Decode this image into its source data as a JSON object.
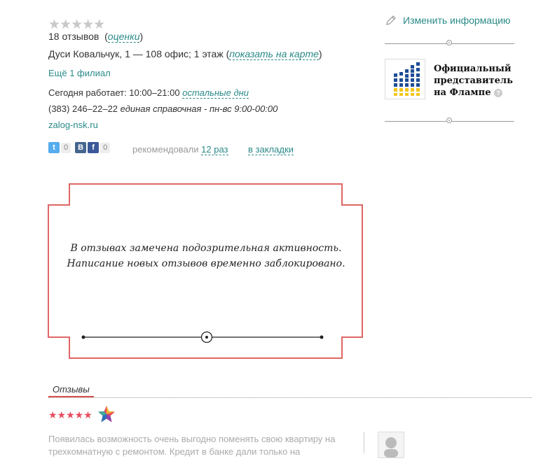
{
  "rating": {
    "stars": "★★★★★"
  },
  "reviews": {
    "count_text": "18 отзывов",
    "rate_link": "оценки"
  },
  "address": {
    "text": "Дуси Ковальчук, 1 — 108 офис; 1 этаж",
    "map_link": "показать на карте"
  },
  "branch_link": "Ещё 1 филиал",
  "hours": {
    "text": "Сегодня работает: 10:00–21:00",
    "other_link": "остальные дни"
  },
  "phone": {
    "number": "(383) 246–22–22",
    "note": "единая справочная - пн-вс 9:00-00:00"
  },
  "website": "zalog-nsk.ru",
  "social": {
    "twitter_count": "0",
    "vk_fb_count": "0"
  },
  "recommend": {
    "text": "рекомендовали",
    "link": "12 раз"
  },
  "bookmark": "в закладки",
  "sidebar": {
    "edit_label": "Изменить информацию",
    "official_line1": "Официальный",
    "official_line2": "представитель",
    "official_line3": "на Флампе",
    "help": "?"
  },
  "warning": {
    "line1": "В отзывах замечена подозрительная активность.",
    "line2": "Написание новых отзывов временно заблокировано."
  },
  "reviews_tab": "Отзывы",
  "review": {
    "stars": "★★★★★",
    "text": "Появилась возможность очень выгодно поменять свою квартиру на трехкомнатную с ремонтом. Кредит в банке дали только на"
  },
  "colors": {
    "accent": "#2a8a88",
    "warning_border": "#e06666",
    "stars": "#e74c5e"
  }
}
